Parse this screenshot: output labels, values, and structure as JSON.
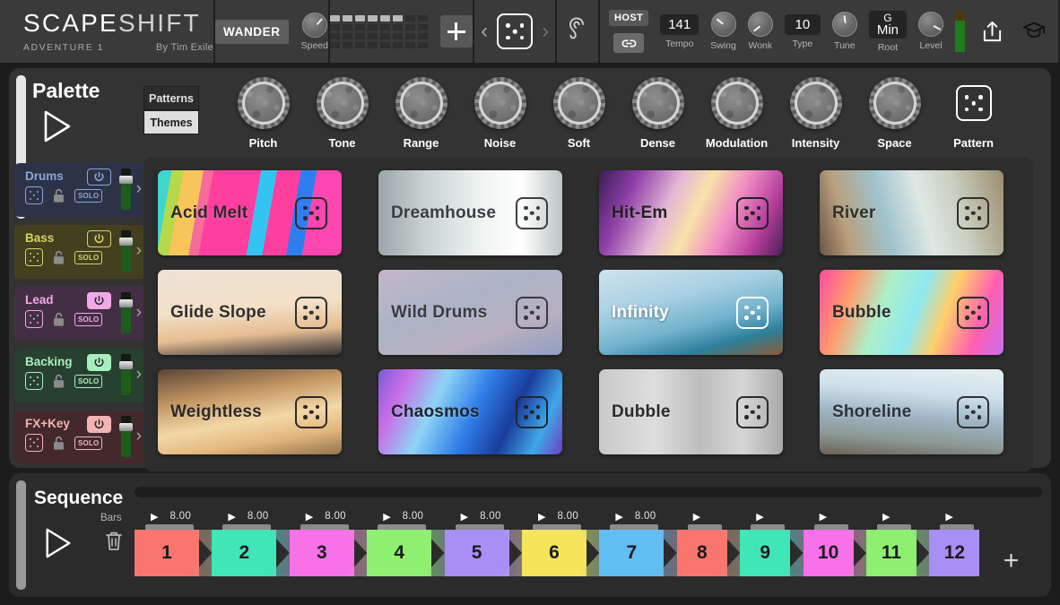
{
  "header": {
    "brand_main": "SCAPE",
    "brand_light": "SHIFT",
    "adventure": "ADVENTURE 1",
    "byline": "By Tim Exile",
    "wander_label": "WANDER",
    "speed_label": "Speed",
    "ear_icon": "ear-icon",
    "plus_icon": "plus-icon",
    "prev_icon": "chevron-left-icon",
    "next_icon": "chevron-right-icon",
    "pattern_dice_icon": "dice-icon",
    "grid_icon": "pattern-grid-icon",
    "host_label": "HOST",
    "link_icon": "link-icon",
    "tempo_value": "141",
    "tempo_label": "Tempo",
    "swing_label": "Swing",
    "wonk_label": "Wonk",
    "type_value": "10",
    "type_label": "Type",
    "tune_label": "Tune",
    "root_value_top": "G",
    "root_value_bottom": "Min",
    "root_label": "Root",
    "level_label": "Level",
    "meter_icon": "level-meter",
    "share_icon": "share-icon",
    "learn_icon": "graduation-cap-icon"
  },
  "palette": {
    "title": "Palette",
    "play_icon": "play-icon",
    "tab_patterns": "Patterns",
    "tab_themes": "Themes",
    "knobs": [
      {
        "label": "Pitch",
        "angle": -35
      },
      {
        "label": "Tone",
        "angle": 10
      },
      {
        "label": "Range",
        "angle": -20
      },
      {
        "label": "Noise",
        "angle": 40
      },
      {
        "label": "Soft",
        "angle": -10
      },
      {
        "label": "Dense",
        "angle": 25
      },
      {
        "label": "Modulation",
        "angle": -45
      },
      {
        "label": "Intensity",
        "angle": 15
      },
      {
        "label": "Space",
        "angle": 55
      }
    ],
    "pattern_label": "Pattern",
    "pattern_icon": "dice-icon",
    "tracks": [
      {
        "name": "Drums",
        "accent": "#8da4d8",
        "bg": "#2d3347",
        "powered": false,
        "solo": "SOLO",
        "dice_icon": "dice-icon",
        "lock_icon": "unlock-icon",
        "arrow_icon": "chevron-right-icon"
      },
      {
        "name": "Bass",
        "accent": "#d8d06a",
        "bg": "#42401f",
        "powered": false,
        "solo": "SOLO",
        "dice_icon": "dice-icon",
        "lock_icon": "unlock-icon",
        "arrow_icon": "chevron-right-icon"
      },
      {
        "name": "Lead",
        "accent": "#f0a8e8",
        "bg": "#432f44",
        "powered": true,
        "solo": "SOLO",
        "dice_icon": "dice-icon",
        "lock_icon": "unlock-icon",
        "arrow_icon": "chevron-right-icon"
      },
      {
        "name": "Backing",
        "accent": "#a8eec0",
        "bg": "#28402f",
        "powered": true,
        "solo": "SOLO",
        "dice_icon": "dice-icon",
        "lock_icon": "unlock-icon",
        "arrow_icon": "chevron-right-icon"
      },
      {
        "name": "FX+Key",
        "accent": "#f3b3b3",
        "bg": "#43292c",
        "powered": true,
        "solo": "SOLO",
        "dice_icon": "dice-icon",
        "lock_icon": "unlock-icon",
        "arrow_icon": "chevron-right-icon"
      }
    ],
    "presets": [
      {
        "name": "Acid Melt",
        "text_color": "#2b2b2b",
        "dice_color": "#2b2b2b",
        "bg": "linear-gradient(100deg,#3fd6d0 0 7%,#b7d84a 7% 13%,#f8c55a 13% 23%,#f76b9a 23% 28%,#ff3fa0 28% 52%,#34c4f2 52% 60%,#ff3fa0 60% 72%,#2f7ef0 72% 80%,#ff45b0 80% 100%)"
      },
      {
        "name": "Dreamhouse",
        "text_color": "#3a3f42",
        "dice_color": "#3a3f42",
        "bg": "linear-gradient(90deg,#9aa6a8 0%,#c7d2d2 25%,#eef3f2 55%,#ffffff 78%,#b9c4c2 100%)"
      },
      {
        "name": "Hit-Em",
        "text_color": "#24201f",
        "dice_color": "#24201f",
        "bg": "linear-gradient(115deg,#3a1d52 0%,#8e3ea8 18%,#e5b7d6 38%,#f7e3a8 52%,#f18ec4 68%,#b53e9c 85%,#4a1f55 100%)"
      },
      {
        "name": "River",
        "text_color": "#31302c",
        "dice_color": "#31302c",
        "bg": "linear-gradient(75deg,#6e5242 0%,#b8a07e 16%,#9fc3cc 36%,#dfe8e4 56%,#c8cfc0 74%,#9d8d6e 100%)"
      },
      {
        "name": "Glide Slope",
        "text_color": "#2f2f2f",
        "dice_color": "#2f2f2f",
        "bg": "linear-gradient(175deg,#ece2d6 0%,#f3e0c6 45%,#e6bd92 72%,#6f6055 90%,#3c3630 100%)"
      },
      {
        "name": "Wild Drums",
        "text_color": "#3b3b42",
        "dice_color": "#3b3b42",
        "bg": "linear-gradient(160deg,#c3b6c9 0%,#aab4c6 40%,#b9b0c0 70%,#8f9ec2 100%)"
      },
      {
        "name": "Infinity",
        "text_color": "#ffffff",
        "dice_color": "#ffffff",
        "bg": "linear-gradient(165deg,#cfe3ee 0%,#a8d0e2 35%,#73b3cd 60%,#2d7f9c 80%,#8a5a34 100%)"
      },
      {
        "name": "Bubble",
        "text_color": "#2d2d2d",
        "dice_color": "#2d2d2d",
        "bg": "linear-gradient(110deg,#ff4da0 0%,#ff9b6e 18%,#aef0c8 35%,#8fe8f0 52%,#ffd06a 66%,#ff5fb0 84%,#c96ef0 100%)"
      },
      {
        "name": "Weightless",
        "text_color": "#2d2a26",
        "dice_color": "#2d2a26",
        "bg": "linear-gradient(170deg,#5a4434 0%,#c49764 32%,#f3d8a8 58%,#e2b67c 78%,#8f7450 100%)"
      },
      {
        "name": "Chaosmos",
        "text_color": "#1f2530",
        "dice_color": "#1f2530",
        "bg": "linear-gradient(115deg,#7a5ad8 0%,#c86ee8 14%,#8fd4f5 32%,#2f7de8 52%,#1a3c9c 70%,#3fa8e8 86%,#6a3fc0 100%)"
      },
      {
        "name": "Dubble",
        "text_color": "#2a2a2a",
        "dice_color": "#2a2a2a",
        "bg": "linear-gradient(90deg,#c9c9c9 0%,#dedede 30%,#bdbdbd 55%,#d6d6d6 78%,#a9a9a9 100%)"
      },
      {
        "name": "Shoreline",
        "text_color": "#2d3238",
        "dice_color": "#2d3238",
        "bg": "linear-gradient(185deg,#e6eef3 0%,#cfe0ea 30%,#9fb4c4 55%,#8d9a96 78%,#6b6256 100%)"
      }
    ]
  },
  "sequence": {
    "title": "Sequence",
    "bars_label": "Bars",
    "play_icon": "play-icon",
    "trash_icon": "trash-icon",
    "add_icon": "add-step-icon",
    "steps": [
      {
        "number": "1",
        "bars": "8.00",
        "color": "#f8766e",
        "wide": true
      },
      {
        "number": "2",
        "bars": "8.00",
        "color": "#40e5b8",
        "wide": true
      },
      {
        "number": "3",
        "bars": "8.00",
        "color": "#f771e8",
        "wide": true
      },
      {
        "number": "4",
        "bars": "8.00",
        "color": "#8ef070",
        "wide": true
      },
      {
        "number": "5",
        "bars": "8.00",
        "color": "#a98ef5",
        "wide": true
      },
      {
        "number": "6",
        "bars": "8.00",
        "color": "#f5e45c",
        "wide": true
      },
      {
        "number": "7",
        "bars": "8.00",
        "color": "#62bdf2",
        "wide": true
      },
      {
        "number": "8",
        "bars": "",
        "color": "#f8766e",
        "wide": false
      },
      {
        "number": "9",
        "bars": "",
        "color": "#40e5b8",
        "wide": false
      },
      {
        "number": "10",
        "bars": "",
        "color": "#f771e8",
        "wide": false
      },
      {
        "number": "11",
        "bars": "",
        "color": "#8ef070",
        "wide": false
      },
      {
        "number": "12",
        "bars": "",
        "color": "#a98ef5",
        "wide": false
      }
    ]
  },
  "colors": {
    "topbar_bg": "#3a3a3a",
    "panel_bg": "#333333",
    "card_area_bg": "#2d2d2d",
    "sequence_bg": "#2b2b2b",
    "accent_white": "#e6e6e6"
  }
}
